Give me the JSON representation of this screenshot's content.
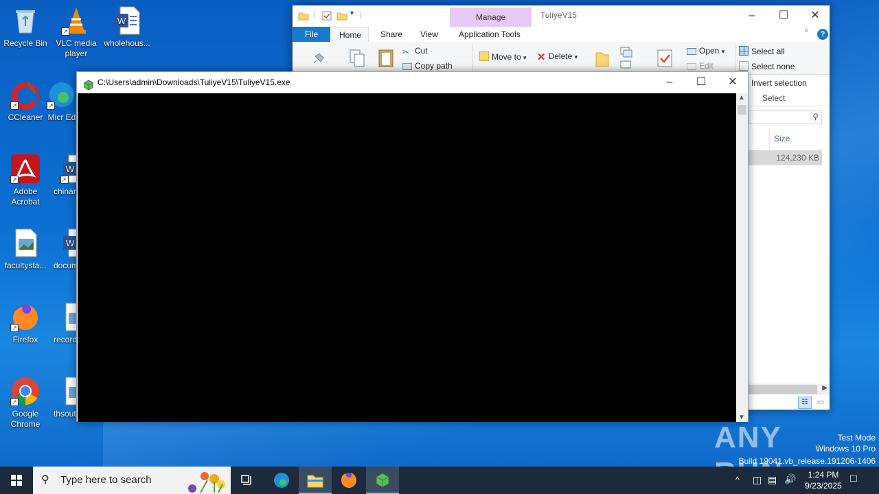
{
  "desktop": {
    "icons": [
      {
        "label": "Recycle Bin"
      },
      {
        "label": "VLC media player"
      },
      {
        "label": "wholehous..."
      },
      {
        "label": "CCleaner"
      },
      {
        "label": "Micr Ed"
      },
      {
        "label": "Adobe Acrobat"
      },
      {
        "label": "chinar"
      },
      {
        "label": "facultysta..."
      },
      {
        "label": "docum"
      },
      {
        "label": "Firefox"
      },
      {
        "label": "record"
      },
      {
        "label": "Google Chrome"
      },
      {
        "label": "thsout"
      }
    ]
  },
  "explorer": {
    "title": "TuliyeV15",
    "context_tab": "Manage",
    "tabs": [
      "File",
      "Home",
      "Share",
      "View",
      "Application Tools"
    ],
    "ribbon": {
      "cut": "Cut",
      "copy_path": "Copy path",
      "move_to": "Move to",
      "delete": "Delete",
      "open": "Open",
      "edit": "Edit",
      "select_all": "Select all",
      "select_none": "Select none",
      "invert_selection": "Invert selection",
      "select_group": "Select"
    },
    "column_size": "Size",
    "file_size": "124,230 KB"
  },
  "console": {
    "title": "C:\\Users\\admin\\Downloads\\TuliyeV15\\TuliyeV15.exe"
  },
  "taskbar": {
    "search_placeholder": "Type here to search",
    "time": "1:24 PM",
    "date": "9/23/2025"
  },
  "watermark": {
    "brand": "ANY RUN",
    "line1": "Test Mode",
    "line2": "Windows 10 Pro",
    "line3": "Build 19041.vb_release.191206-1406"
  },
  "colors": {
    "accent": "#1979ca",
    "manage": "#e7c9f5",
    "taskbar": "#1c2a3b"
  }
}
